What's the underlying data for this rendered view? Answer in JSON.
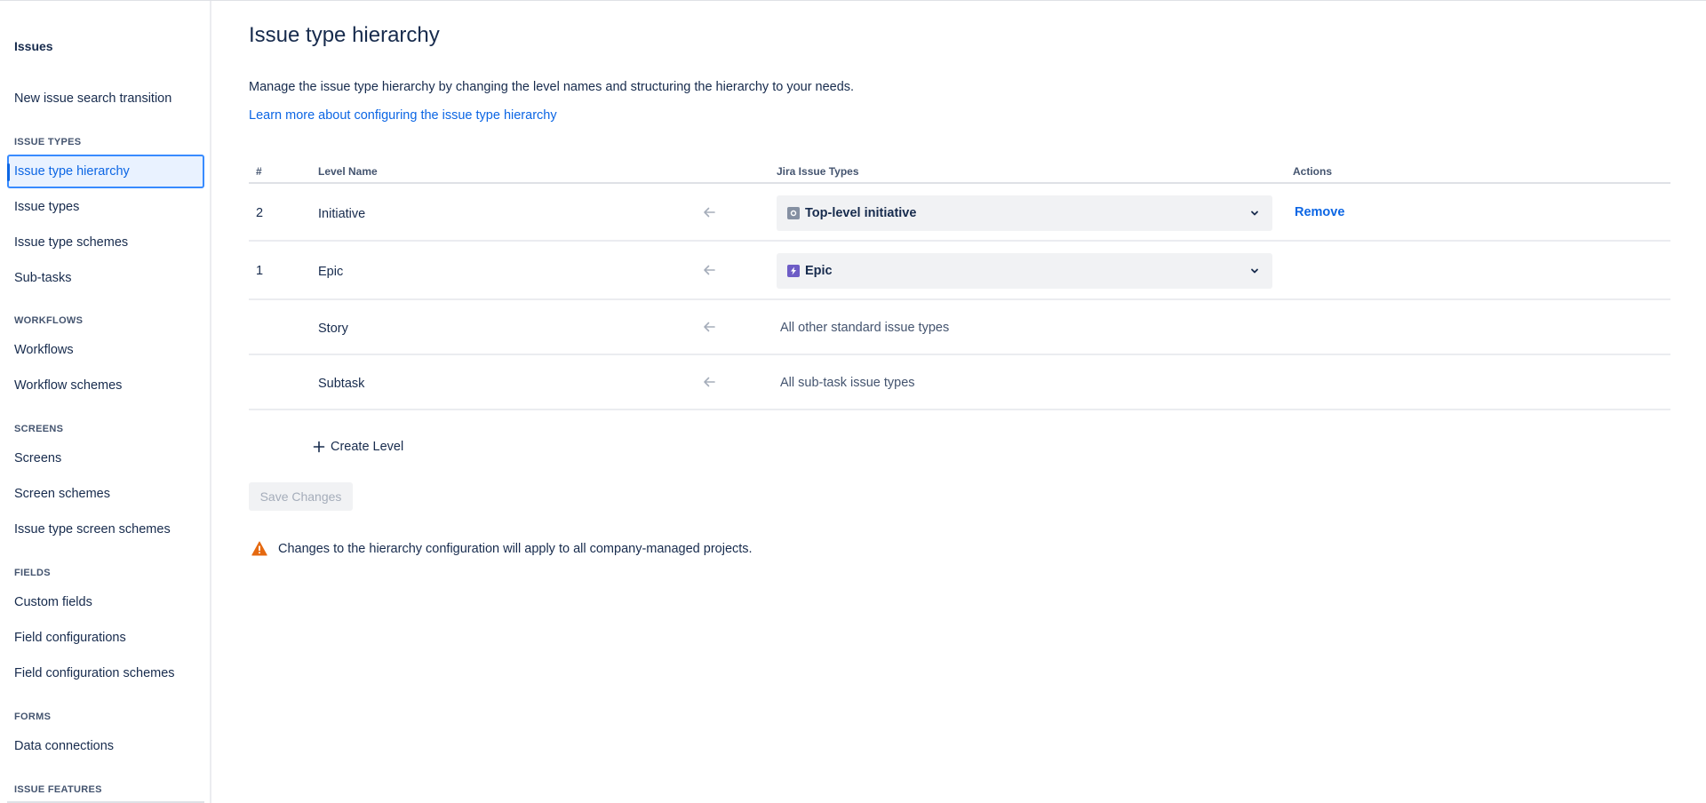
{
  "sidebar": {
    "title": "Issues",
    "top_item": "New issue search transition",
    "sections": [
      {
        "heading": "ISSUE TYPES",
        "items": [
          "Issue type hierarchy",
          "Issue types",
          "Issue type schemes",
          "Sub-tasks"
        ]
      },
      {
        "heading": "WORKFLOWS",
        "items": [
          "Workflows",
          "Workflow schemes"
        ]
      },
      {
        "heading": "SCREENS",
        "items": [
          "Screens",
          "Screen schemes",
          "Issue type screen schemes"
        ]
      },
      {
        "heading": "FIELDS",
        "items": [
          "Custom fields",
          "Field configurations",
          "Field configuration schemes"
        ]
      },
      {
        "heading": "FORMS",
        "items": [
          "Data connections"
        ]
      },
      {
        "heading": "ISSUE FEATURES",
        "items": []
      }
    ],
    "active_item": "Issue type hierarchy"
  },
  "main": {
    "title": "Issue type hierarchy",
    "description": "Manage the issue type hierarchy by changing the level names and structuring the hierarchy to your needs.",
    "learn_more": "Learn more about configuring the issue type hierarchy",
    "table": {
      "headers": {
        "num": "#",
        "level": "Level Name",
        "types": "Jira Issue Types",
        "actions": "Actions"
      },
      "rows": [
        {
          "num": "2",
          "level": "Initiative",
          "type": "Top-level initiative",
          "type_icon": "initiative-icon",
          "action": "Remove"
        },
        {
          "num": "1",
          "level": "Epic",
          "type": "Epic",
          "type_icon": "epic-icon",
          "action": ""
        },
        {
          "num": "",
          "level": "Story",
          "type": "All other standard issue types",
          "action": ""
        },
        {
          "num": "",
          "level": "Subtask",
          "type": "All sub-task issue types",
          "action": ""
        }
      ]
    },
    "create_level": "Create Level",
    "save_changes": "Save Changes",
    "warning": "Changes to the hierarchy configuration will apply to all company-managed projects."
  },
  "colors": {
    "accent": "#0c66e4",
    "active_bg": "#e9f2ff",
    "warning": "#e56910",
    "epic": "#6e5dc6",
    "initiative": "#8590a2"
  }
}
